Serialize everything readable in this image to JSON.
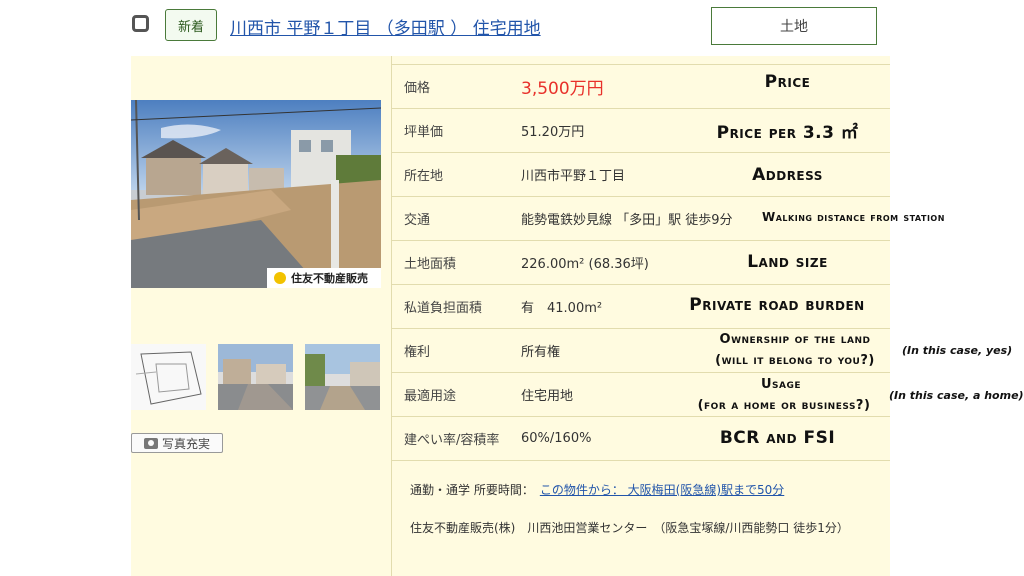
{
  "listing": {
    "new_badge": "新着",
    "title": "川西市 平野１丁目 （多田駅 ） 住宅用地",
    "type_button": "土地",
    "photo_logo": "住友不動産販売",
    "photos_button": "写真充実"
  },
  "rows": [
    {
      "key": "価格",
      "value": "3,500万円",
      "annotation": "Price"
    },
    {
      "key": "坪単価",
      "value": "51.20万円",
      "annotation": "Price per 3.3 ㎡"
    },
    {
      "key": "所在地",
      "value": "川西市平野１丁目",
      "annotation": "Address"
    },
    {
      "key": "交通",
      "value": "能勢電鉄妙見線 「多田」駅 徒歩9分",
      "annotation": "Walking distance from station"
    },
    {
      "key": "土地面積",
      "value": "226.00m² (68.36坪)",
      "annotation": "Land size"
    },
    {
      "key": "私道負担面積",
      "value": "有　41.00m²",
      "annotation": "Private road burden"
    },
    {
      "key": "権利",
      "value": "所有権",
      "annotation_line1": "Ownership of the land",
      "annotation_line2": "(will it belong to you?)",
      "note": "(In this case, yes)"
    },
    {
      "key": "最適用途",
      "value": "住宅用地",
      "annotation_line1": "Usage",
      "annotation_line2": "(for a home or business?)",
      "note": "(In this case, a home)"
    },
    {
      "key": "建ぺい率/容積率",
      "value": "60%/160%",
      "annotation": "BCR and FSI"
    }
  ],
  "commute": {
    "label": "通勤・通学 所要時間：",
    "link": "この物件から： 大阪梅田(阪急線)駅まで50分"
  },
  "agent": "住友不動産販売(株)　川西池田営業センター　（阪急宝塚線/川西能勢口 徒歩1分）",
  "colors": {
    "accent_link": "#2255aa",
    "price": "#e8302a",
    "panel": "#fffbe0",
    "border_green": "#4a7a3a"
  }
}
